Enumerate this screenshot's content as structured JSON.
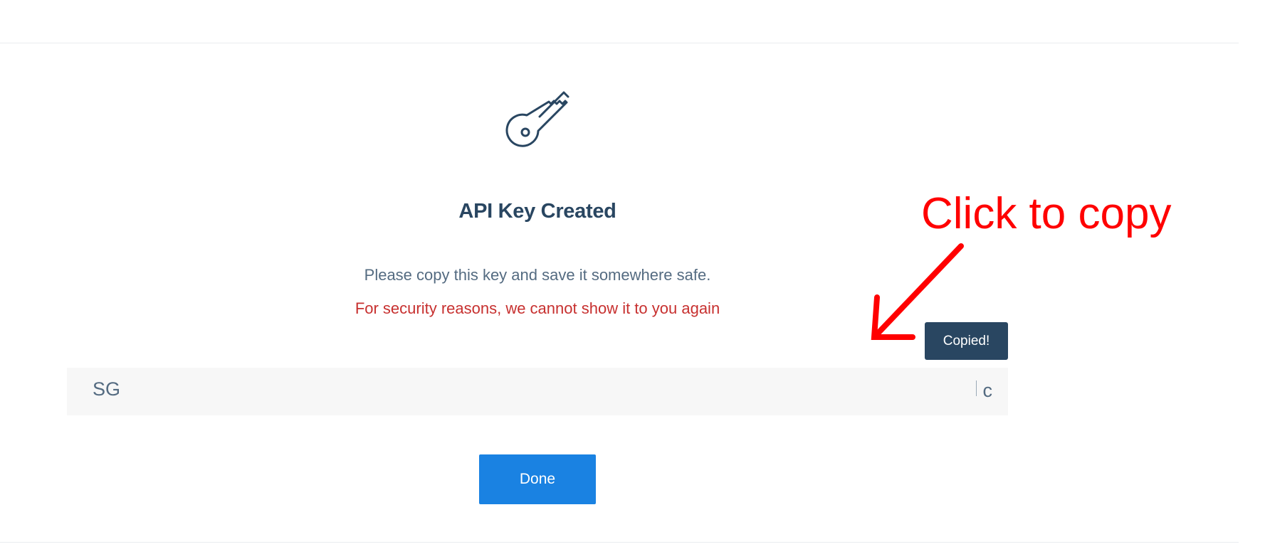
{
  "dialog": {
    "title": "API Key Created",
    "subtitle": "Please copy this key and save it somewhere safe.",
    "warning": "For security reasons, we cannot show it to you again",
    "key_prefix": "SG",
    "key_suffix": "c",
    "tooltip": "Copied!",
    "done_label": "Done"
  },
  "annotation": {
    "text": "Click to copy",
    "color": "#ff0000"
  },
  "colors": {
    "title": "#294661",
    "body_text": "#546b81",
    "warning": "#c7302f",
    "button": "#1a82e2",
    "tooltip_bg": "#294661"
  },
  "icons": {
    "hero": "key-icon",
    "annotation": "arrow-icon"
  }
}
